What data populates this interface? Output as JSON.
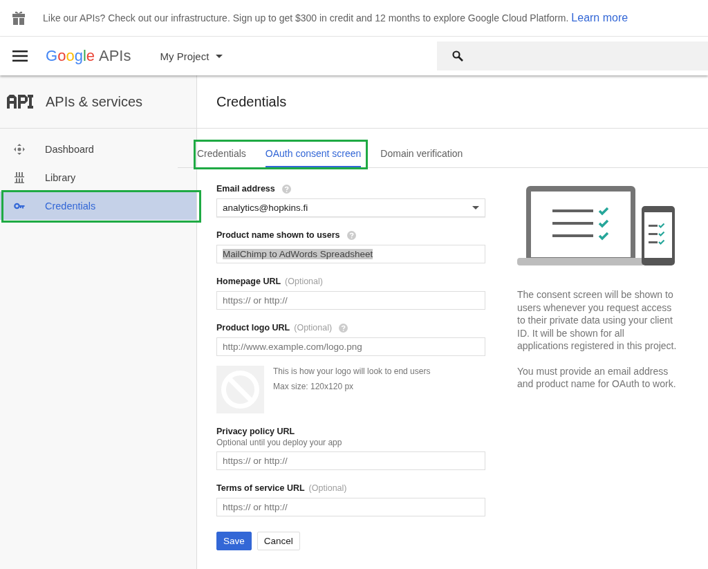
{
  "banner": {
    "text": "Like our APIs? Check out our infrastructure. Sign up to get $300 in credit and 12 months to explore Google Cloud Platform.",
    "link": "Learn more"
  },
  "header": {
    "logo_word": "Google",
    "logo_suffix": "APIs",
    "project": "My Project"
  },
  "sidebar": {
    "title": "APIs & services",
    "items": [
      {
        "label": "Dashboard",
        "kind": "dashboard",
        "selected": false,
        "highlighted": false
      },
      {
        "label": "Library",
        "kind": "library",
        "selected": false,
        "highlighted": false
      },
      {
        "label": "Credentials",
        "kind": "key",
        "selected": true,
        "highlighted": true
      }
    ]
  },
  "page_title": "Credentials",
  "tabs": {
    "highlighted": true,
    "items": [
      {
        "label": "Credentials",
        "selected": false
      },
      {
        "label": "OAuth consent screen",
        "selected": true
      },
      {
        "label": "Domain verification",
        "selected": false
      }
    ]
  },
  "form": {
    "fields": [
      {
        "kind": "select",
        "label": "Email address",
        "help": true,
        "value": "analytics@hopkins.fi"
      },
      {
        "kind": "text",
        "label": "Product name shown to users",
        "help": true,
        "value": "MailChimp to AdWords Spreadsheet",
        "value_selected": true
      },
      {
        "kind": "text",
        "label": "Homepage URL",
        "note": "(Optional)",
        "help": false,
        "placeholder": "https:// or http://"
      },
      {
        "kind": "logo",
        "label": "Product logo URL",
        "note": "(Optional)",
        "help": true,
        "placeholder": "http://www.example.com/logo.png",
        "preview_text": "This is how your logo will look to end users",
        "preview_size": "Max size: 120x120 px"
      },
      {
        "kind": "text",
        "label": "Privacy policy URL",
        "sublabel": "Optional until you deploy your app",
        "help": false,
        "placeholder": "https:// or http://"
      },
      {
        "kind": "text",
        "label": "Terms of service URL",
        "note": "(Optional)",
        "help": false,
        "placeholder": "https:// or http://"
      }
    ],
    "buttons": [
      {
        "label": "Save",
        "kind": "primary"
      },
      {
        "label": "Cancel",
        "kind": "secondary"
      }
    ]
  },
  "info": [
    "The consent screen will be shown to users whenever you request access to their private data using your client ID. It will be shown for all applications registered in this project.",
    "You must provide an email address and product name for OAuth to work."
  ]
}
